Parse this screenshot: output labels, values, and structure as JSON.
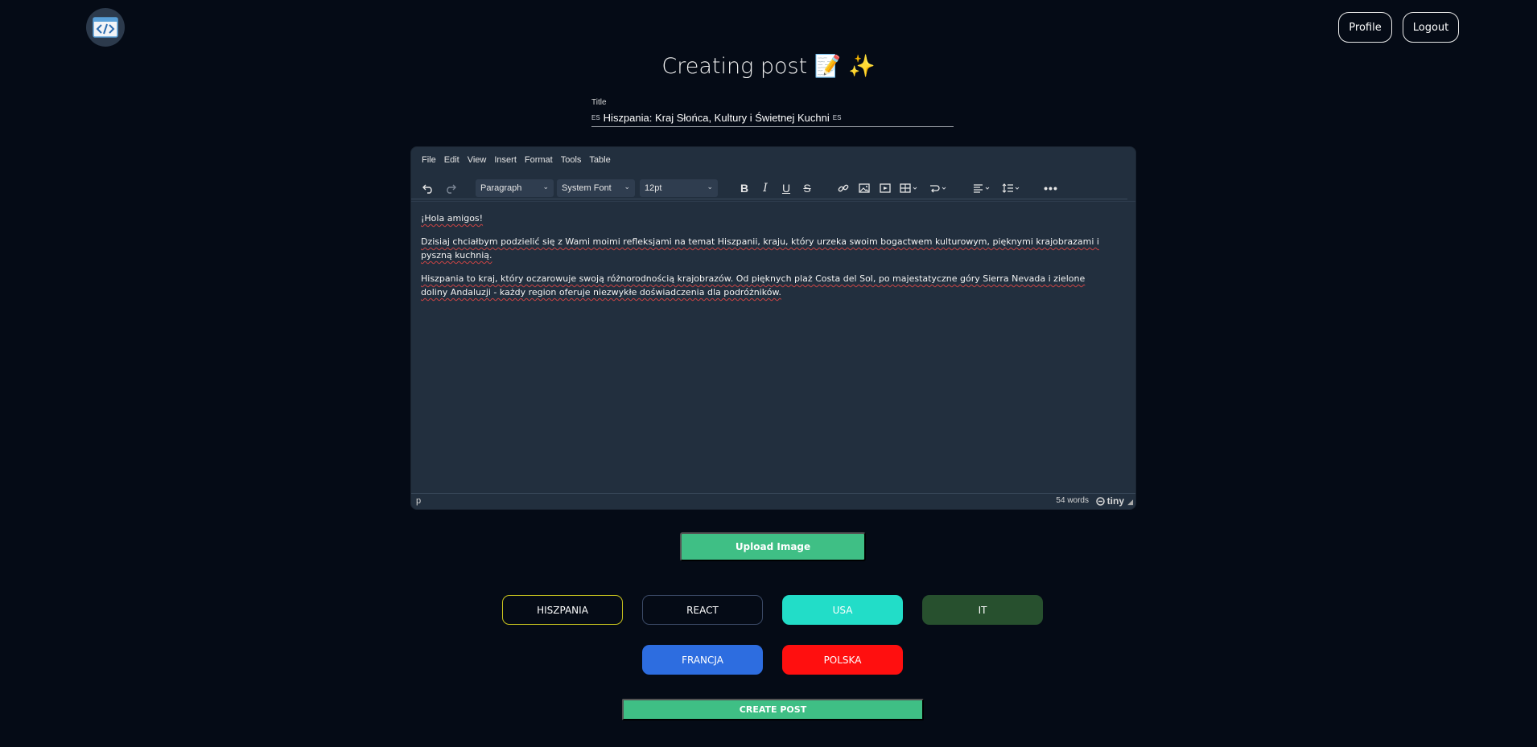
{
  "header": {
    "logo_icon": "code-brackets-icon",
    "profile_label": "Profile",
    "logout_label": "Logout"
  },
  "page": {
    "title": "Creating post 📝 ✨"
  },
  "title_field": {
    "label": "Title",
    "tag_left": "ES",
    "value": "Hiszpania: Kraj Słońca, Kultury i Świetnej Kuchni",
    "tag_right": "ES"
  },
  "editor": {
    "menu": [
      "File",
      "Edit",
      "View",
      "Insert",
      "Format",
      "Tools",
      "Table"
    ],
    "block_format": "Paragraph",
    "font_family": "System Font",
    "font_size": "12pt",
    "paragraphs": [
      "¡Hola amigos!",
      "Dzisiaj chciałbym podzielić się z Wami moimi refleksjami na temat Hiszpanii, kraju, który urzeka swoim bogactwem kulturowym, pięknymi krajobrazami i pyszną kuchnią.",
      "Hiszpania to kraj, który oczarowuje swoją różnorodnością krajobrazów. Od pięknych plaż Costa del Sol, po majestatyczne góry Sierra Nevada i zielone doliny Andaluzji - każdy region oferuje niezwykłe doświadczenia dla podróżników."
    ],
    "status_path": "p",
    "word_count": "54 words",
    "brand": "tiny"
  },
  "upload_label": "Upload Image",
  "tags": [
    {
      "label": "HISZPANIA",
      "bg": "transparent",
      "border": "#c9c41e"
    },
    {
      "label": "REACT",
      "bg": "transparent",
      "border": "#3b4a66"
    },
    {
      "label": "USA",
      "bg": "#22ddc8",
      "border": "#22ddc8"
    },
    {
      "label": "IT",
      "bg": "#27502e",
      "border": "#27502e"
    },
    {
      "label": "FRANCJA",
      "bg": "#2d6de0",
      "border": "#2d6de0"
    },
    {
      "label": "POLSKA",
      "bg": "#ff0f0f",
      "border": "#ff0f0f"
    }
  ],
  "create_label": "CREATE POST",
  "colors": {
    "background": "#050b16",
    "accent_green": "#3fbf85",
    "editor_bg": "#222f3e"
  }
}
